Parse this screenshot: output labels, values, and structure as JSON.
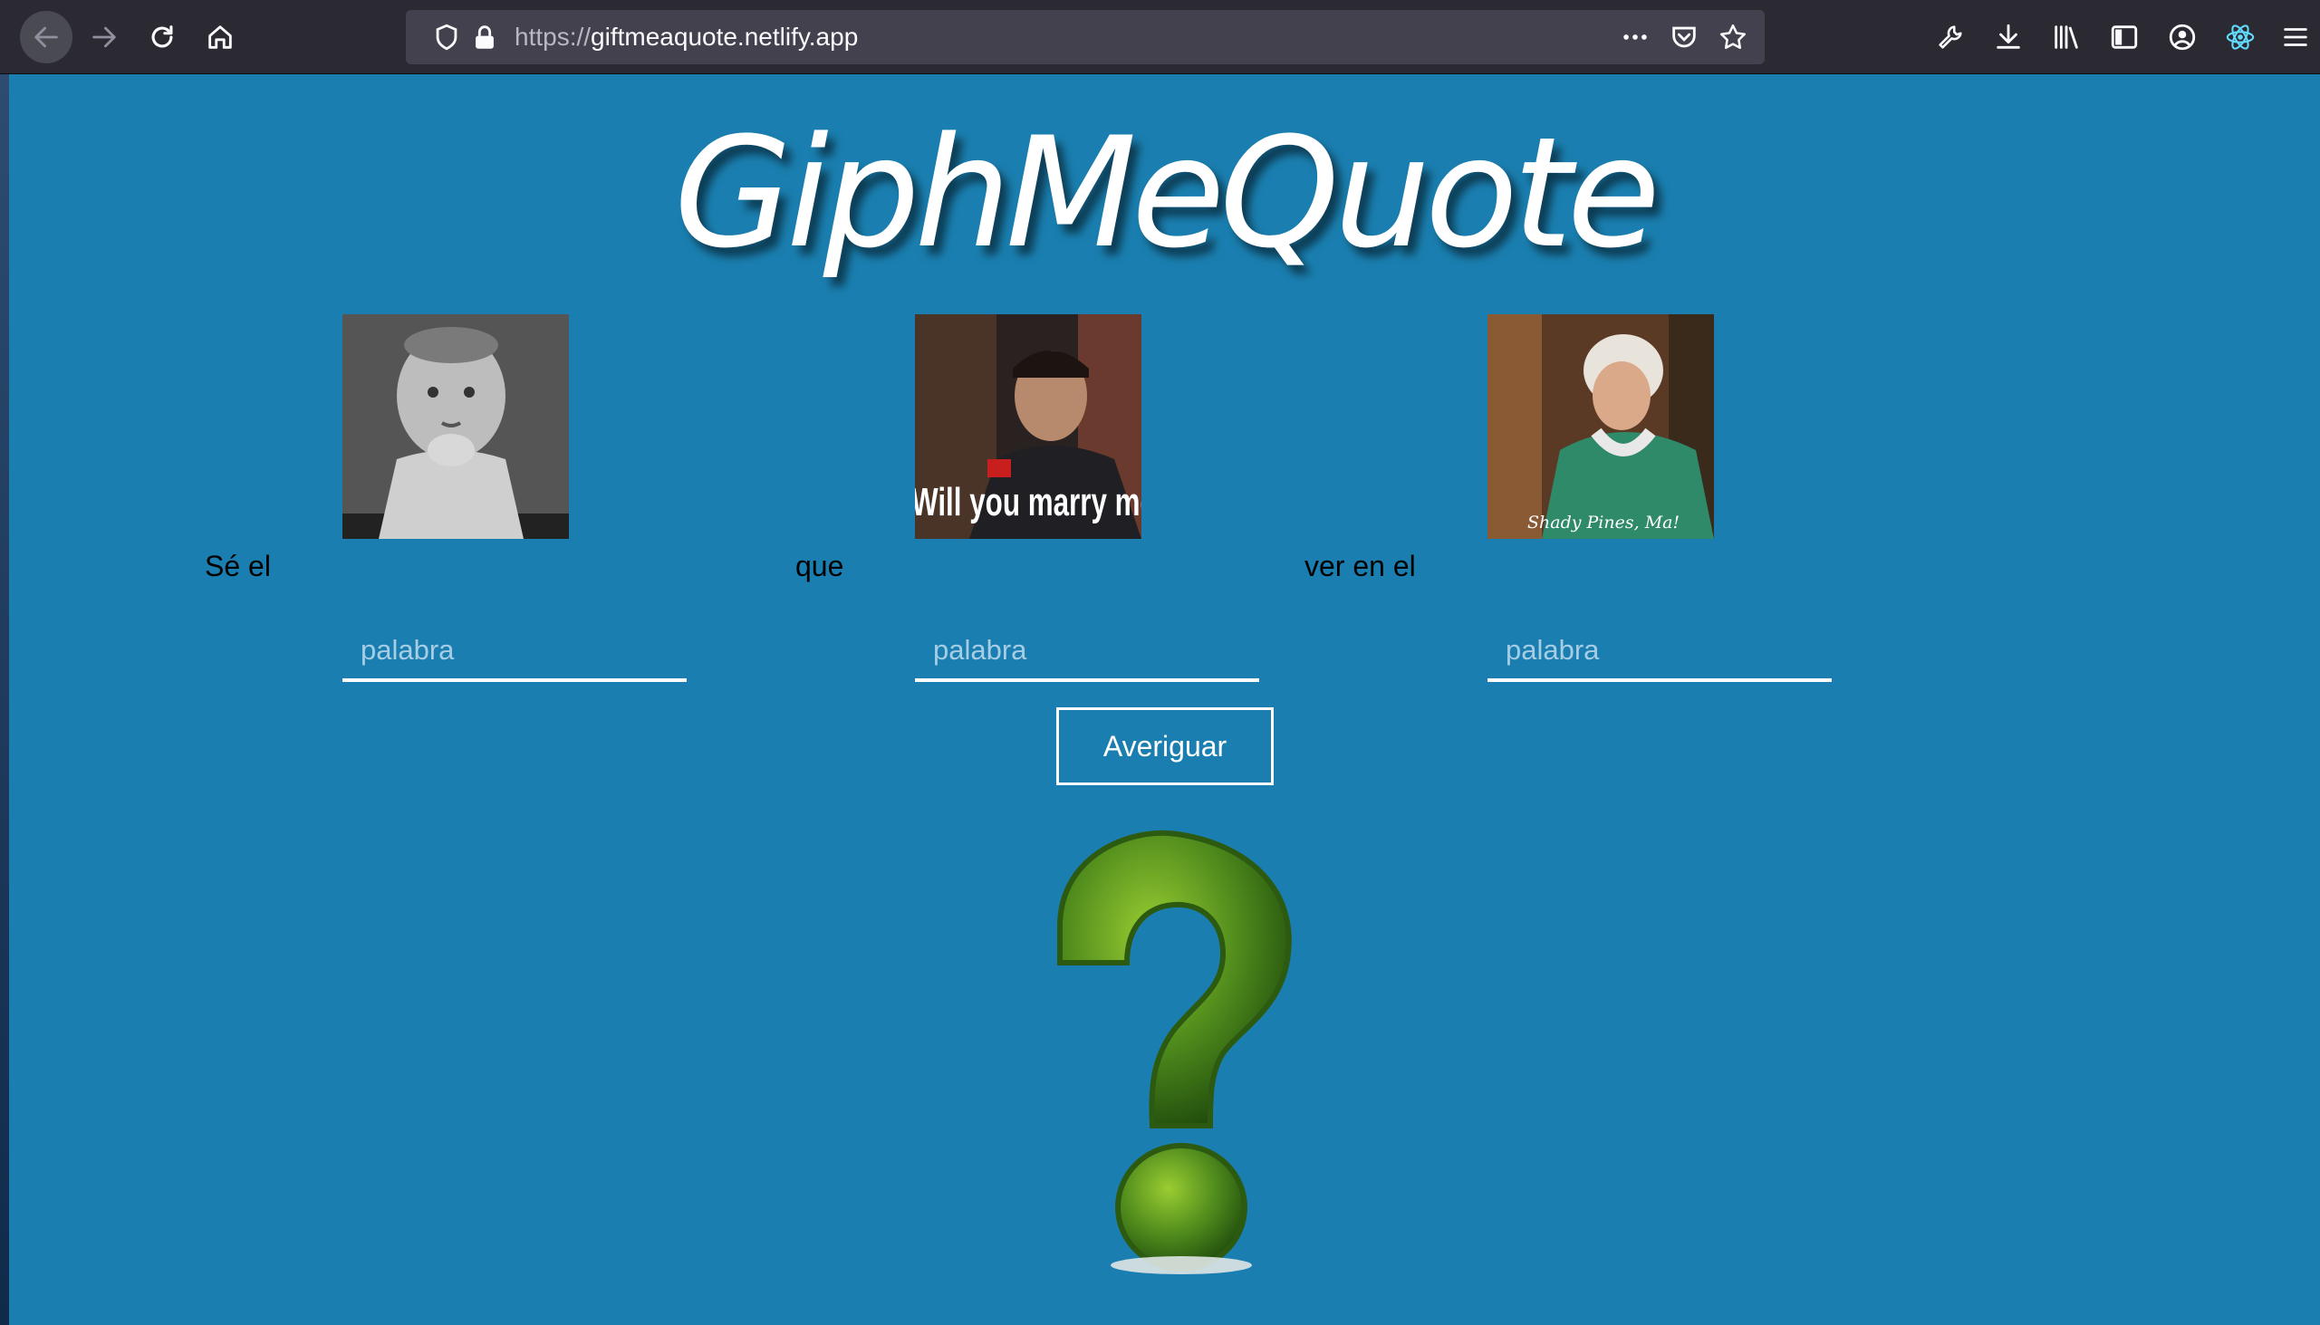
{
  "browser": {
    "url_prefix": "https://",
    "url_domain": "giftmeaquote.netlify.app"
  },
  "page": {
    "title": "GiphMeQuote",
    "phrase": [
      {
        "label": "Sé el",
        "placeholder": "palabra",
        "gif_caption": ""
      },
      {
        "label": "que",
        "placeholder": "palabra",
        "gif_caption": "Will you marry me"
      },
      {
        "label": "ver en el",
        "placeholder": "palabra",
        "gif_caption": "Shady Pines, Ma!"
      }
    ],
    "submit_label": "Averiguar"
  },
  "icons": {
    "toolbar": [
      "back-icon",
      "forward-icon",
      "reload-icon",
      "home-icon"
    ],
    "urlbar": [
      "shield-icon",
      "lock-icon",
      "more-icon",
      "pocket-icon",
      "star-icon"
    ],
    "extensions": [
      "wrench-icon",
      "download-icon",
      "library-icon",
      "sidebar-icon",
      "account-icon",
      "react-devtools-icon",
      "menu-icon"
    ]
  },
  "colors": {
    "page_background": "#1a7fb0",
    "chrome_background": "#2b2a33",
    "urlbar_background": "#42414d",
    "accent": "#ffffff"
  }
}
